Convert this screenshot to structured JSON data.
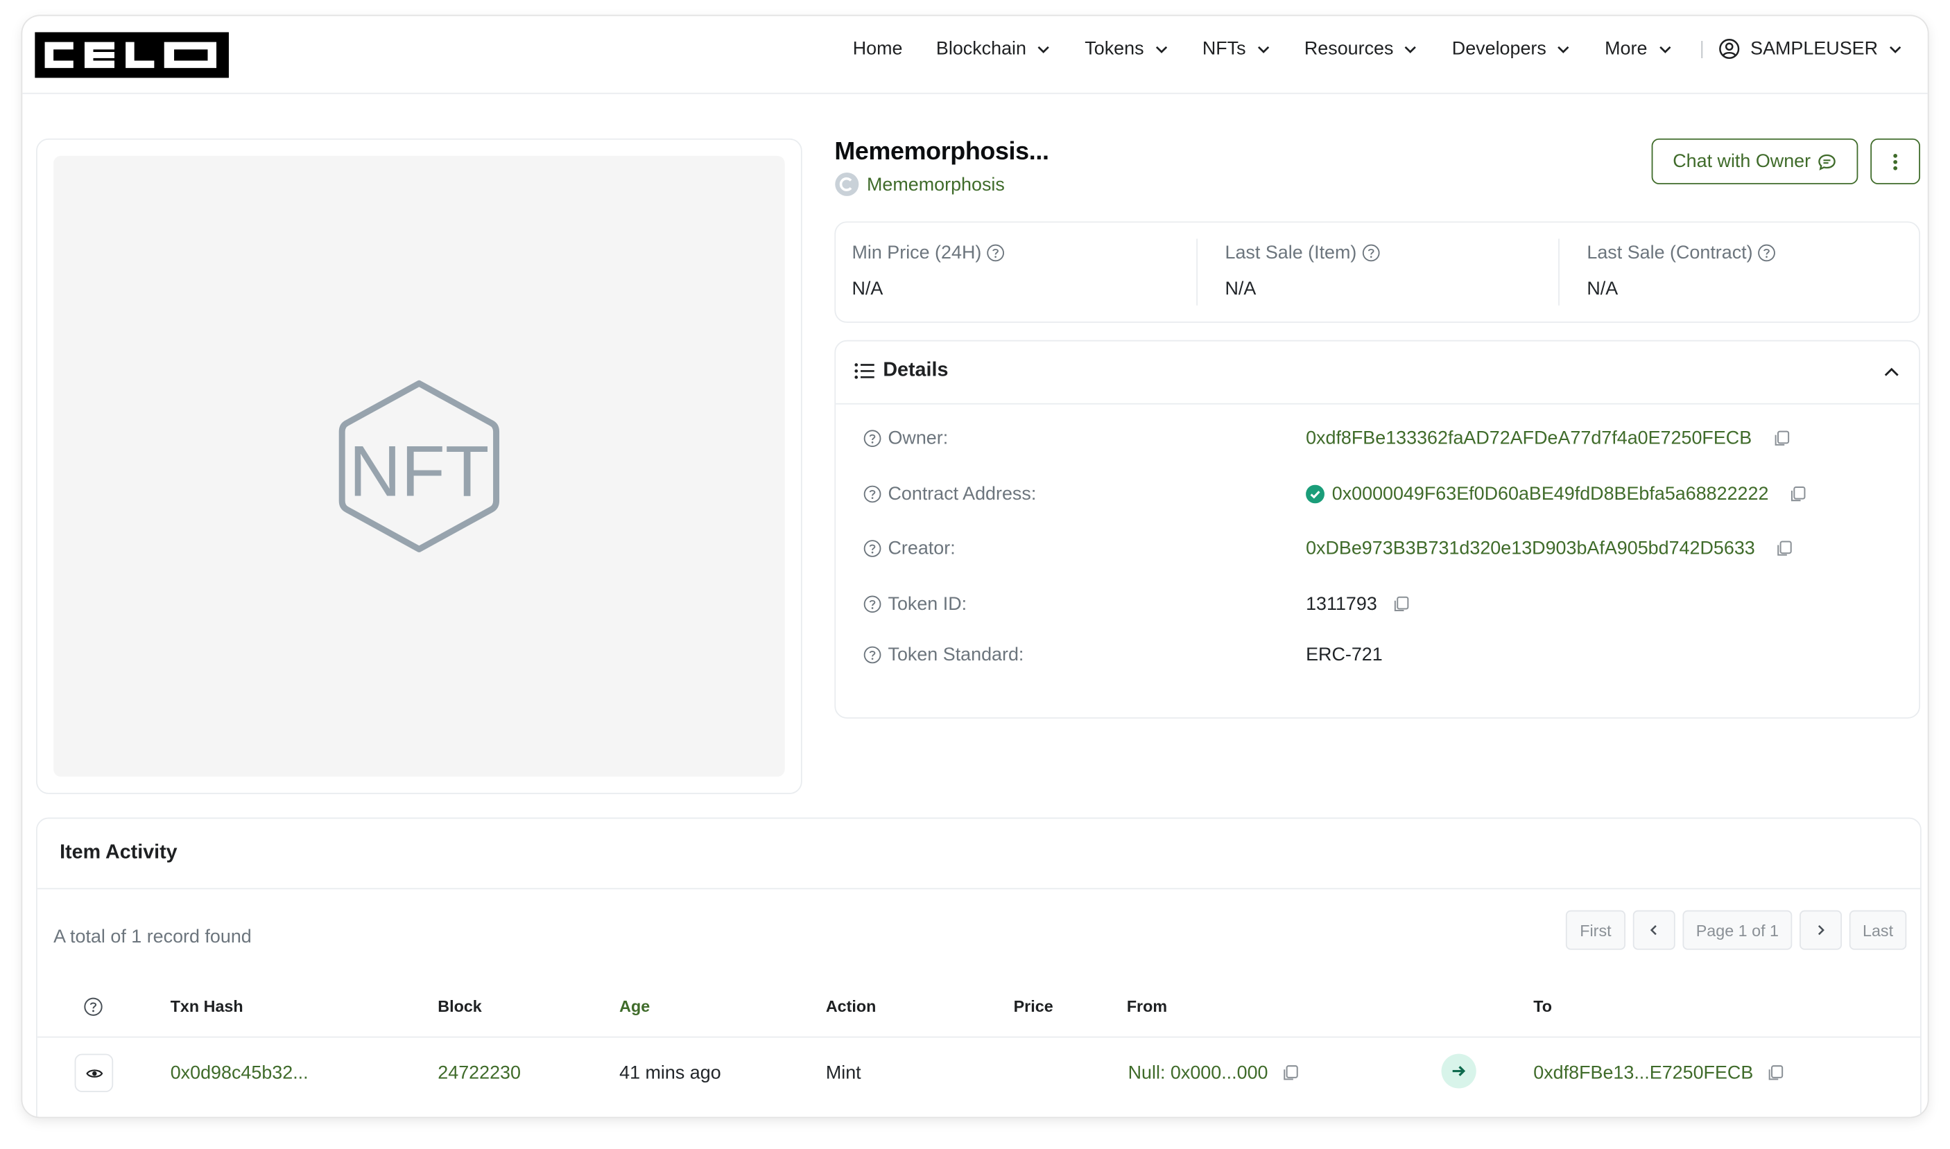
{
  "header": {
    "logo_text": "CELO",
    "nav": [
      {
        "label": "Home",
        "dropdown": false
      },
      {
        "label": "Blockchain",
        "dropdown": true
      },
      {
        "label": "Tokens",
        "dropdown": true
      },
      {
        "label": "NFTs",
        "dropdown": true
      },
      {
        "label": "Resources",
        "dropdown": true
      },
      {
        "label": "Developers",
        "dropdown": true
      },
      {
        "label": "More",
        "dropdown": true
      }
    ],
    "separator": "|",
    "user": "SAMPLEUSER"
  },
  "nft": {
    "placeholder_text": "NFT",
    "title": "Mememorphosis...",
    "collection": "Mememorphosis",
    "chat_button": "Chat with Owner"
  },
  "stats": [
    {
      "label": "Min Price (24H)",
      "value": "N/A"
    },
    {
      "label": "Last Sale (Item)",
      "value": "N/A"
    },
    {
      "label": "Last Sale (Contract)",
      "value": "N/A"
    }
  ],
  "details": {
    "title": "Details",
    "rows": [
      {
        "label": "Owner:",
        "value": "0xdf8FBe133362faAD72AFDeA77d7f4a0E7250FECB"
      },
      {
        "label": "Contract Address:",
        "value": "0x0000049F63Ef0D60aBE49fdD8BEbfa5a68822222"
      },
      {
        "label": "Creator:",
        "value": "0xDBe973B3B731d320e13D903bAfA905bd742D5633"
      },
      {
        "label": "Token ID:",
        "value": "1311793"
      },
      {
        "label": "Token Standard:",
        "value": "ERC-721"
      }
    ]
  },
  "activity": {
    "title": "Item Activity",
    "records": "A total of 1 record found",
    "pager": {
      "first": "First",
      "page": "Page 1 of 1",
      "last": "Last"
    },
    "columns": [
      "Txn Hash",
      "Block",
      "Age",
      "Action",
      "Price",
      "From",
      "To"
    ],
    "rows": [
      {
        "txn_hash": "0x0d98c45b32...",
        "block": "24722230",
        "age": "41 mins ago",
        "action": "Mint",
        "price": "",
        "from": "Null: 0x000...000",
        "to": "0xdf8FBe13...E7250FECB"
      }
    ]
  },
  "colors": {
    "accent": "#3f6b2a",
    "verified": "#1a9d79",
    "border": "#e9ecef"
  }
}
